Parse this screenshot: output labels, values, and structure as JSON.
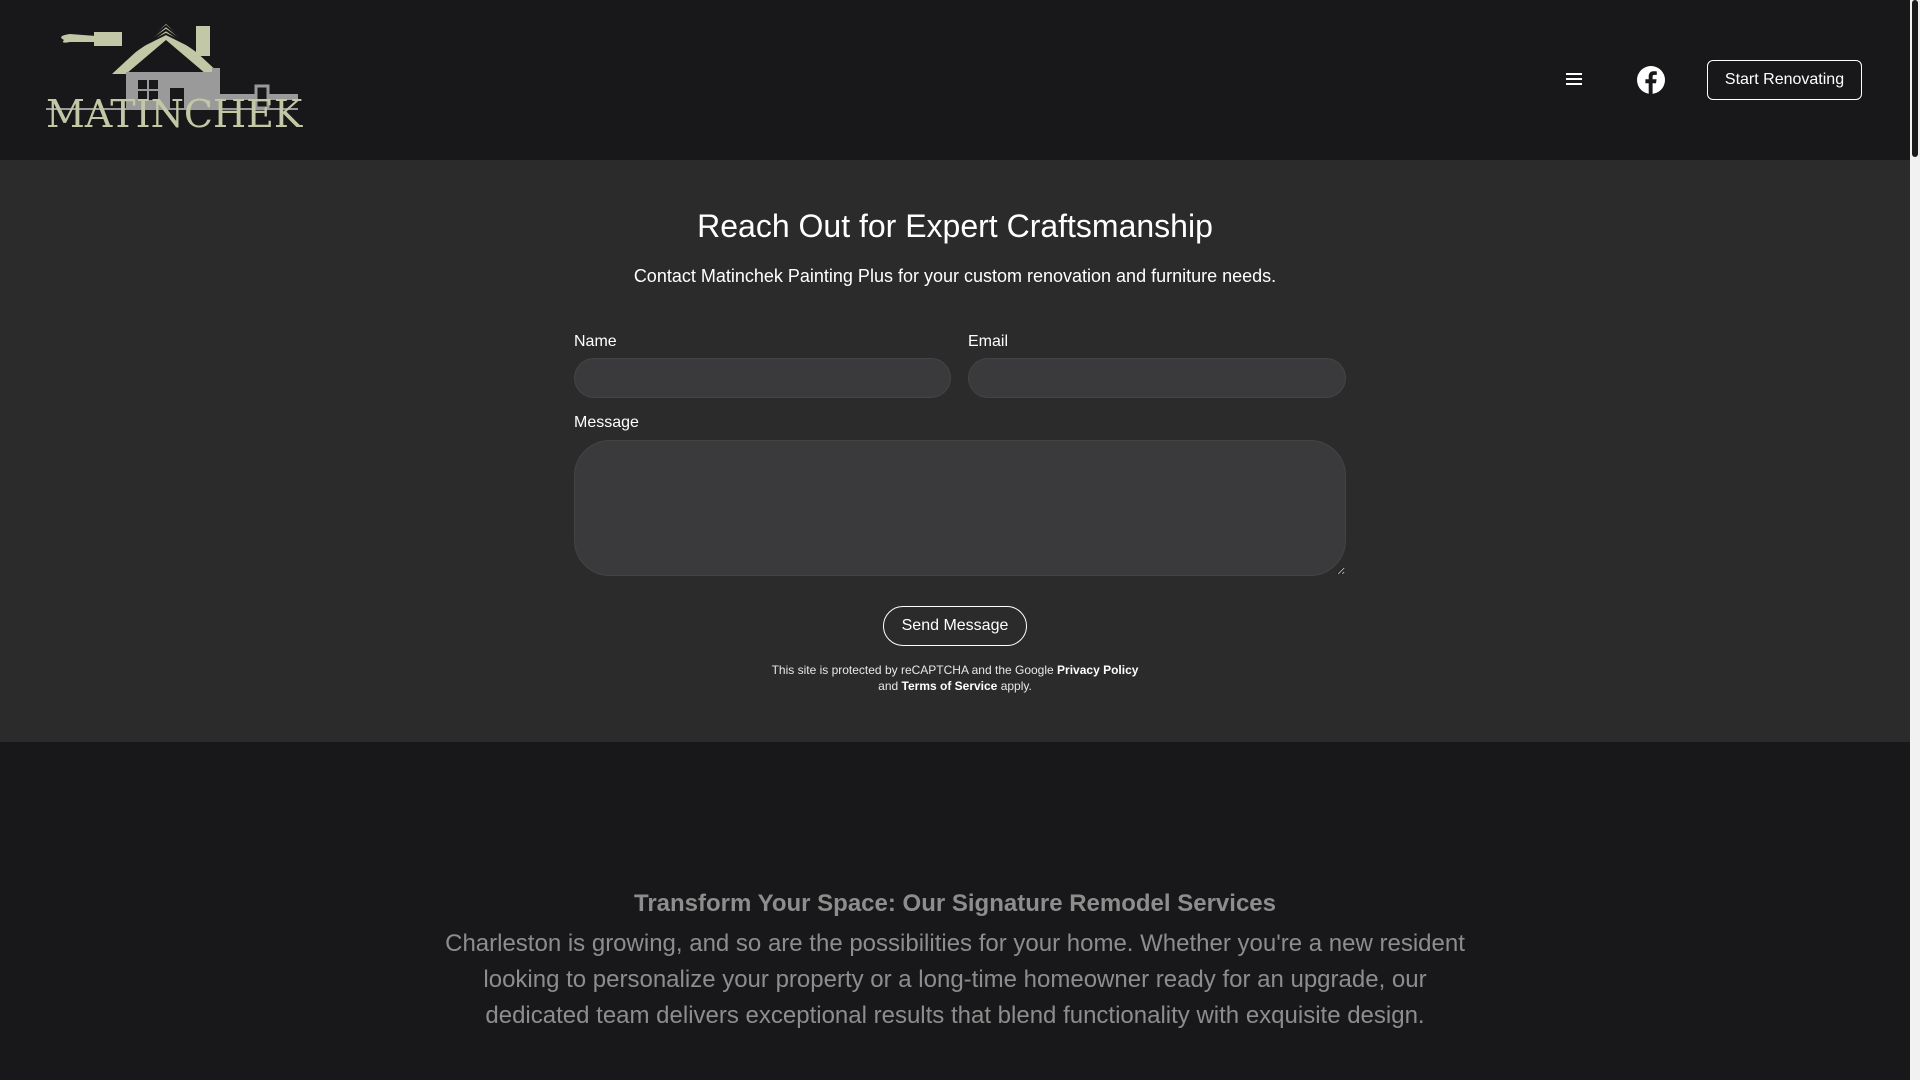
{
  "header": {
    "logo_text": "MATINCHEK",
    "cta_label": "Start Renovating"
  },
  "contact": {
    "title": "Reach Out for Expert Craftsmanship",
    "subtitle": "Contact Matinchek Painting Plus for your custom renovation and furniture needs.",
    "name_label": "Name",
    "name_value": "",
    "email_label": "Email",
    "email_value": "",
    "message_label": "Message",
    "message_value": "",
    "send_label": "Send Message",
    "legal_prefix": "This site is protected by reCAPTCHA and the Google",
    "privacy_label": "Privacy Policy",
    "legal_and": "and",
    "terms_label": "Terms of Service",
    "legal_suffix": "apply."
  },
  "services": {
    "title": "Transform Your Space: Our Signature Remodel Services",
    "body": "Charleston is growing, and so are the possibilities for your home. Whether you're a new resident looking to personalize your property or a long-time homeowner ready for an upgrade, our dedicated team delivers exceptional results that blend functionality with exquisite design."
  },
  "colors": {
    "page_bg": "#18181a",
    "section_bg": "#2b2b2b",
    "field_bg": "#3a3a3c",
    "logo_accent": "#c2c8a6",
    "muted_text": "#8d8d8d"
  },
  "icons": [
    "menu-icon",
    "facebook-icon"
  ]
}
